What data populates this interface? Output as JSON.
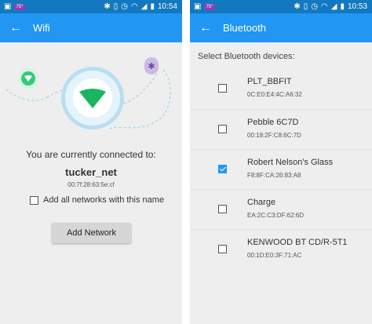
{
  "wifi_screen": {
    "statusbar": {
      "badge": "75°",
      "time": "10:54"
    },
    "toolbar": {
      "title": "Wifi"
    },
    "connected_label": "You are currently connected to:",
    "ssid": "tucker_net",
    "mac": "00:7f:28:63:5e:cf",
    "all_networks_label": "Add all networks with this name",
    "all_networks_checked": false,
    "add_network_label": "Add Network"
  },
  "bt_screen": {
    "statusbar": {
      "badge": "75°",
      "time": "10:53"
    },
    "toolbar": {
      "title": "Bluetooth"
    },
    "header": "Select Bluetooth devices:",
    "devices": [
      {
        "name": "PLT_BBFIT",
        "mac": "0C:E0:E4:4C:A6:32",
        "checked": false
      },
      {
        "name": "Pebble 6C7D",
        "mac": "00:18:2F:C8:6C:7D",
        "checked": false
      },
      {
        "name": "Robert Nelson's Glass",
        "mac": "F8:8F:CA:26:83:A8",
        "checked": true
      },
      {
        "name": "Charge",
        "mac": "EA:2C:C3:DF:62:6D",
        "checked": false
      },
      {
        "name": "KENWOOD BT CD/R-5T1",
        "mac": "00:1D:E0:3F:71:AC",
        "checked": false
      }
    ]
  },
  "colors": {
    "statusbar": "#1279c1",
    "toolbar": "#2196f3",
    "wifi_accent": "#1ab561",
    "bt_accent": "#8b6bd0"
  }
}
